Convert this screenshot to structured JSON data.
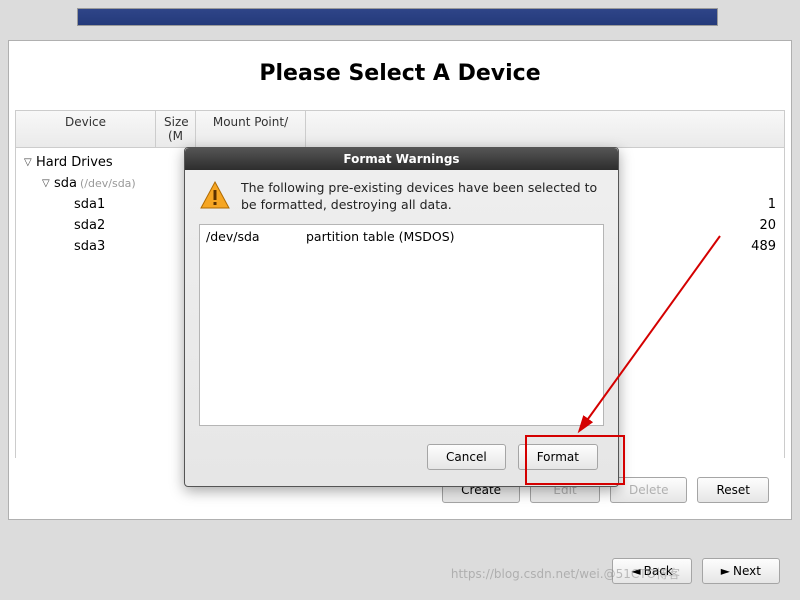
{
  "page": {
    "title": "Please Select A Device"
  },
  "table_headers": {
    "device": "Device",
    "size": "Size\n(M",
    "mount": "Mount Point/"
  },
  "tree": {
    "root_label": "Hard Drives",
    "disk": {
      "label": "sda",
      "path": "(/dev/sda)"
    },
    "parts": [
      {
        "name": "sda1",
        "size": "1"
      },
      {
        "name": "sda2",
        "size": "20"
      },
      {
        "name": "sda3",
        "size": "489"
      }
    ]
  },
  "buttons": {
    "create": "Create",
    "edit": "Edit",
    "delete": "Delete",
    "reset": "Reset",
    "back": "Back",
    "next": "Next"
  },
  "dialog": {
    "title": "Format Warnings",
    "message": "The following pre-existing devices have been selected to be formatted, destroying all data.",
    "rows": [
      {
        "dev": "/dev/sda",
        "desc": "partition table (MSDOS)"
      }
    ],
    "cancel": "Cancel",
    "format": "Format"
  },
  "watermark": "https://blog.csdn.net/wei.@51CTO博客"
}
